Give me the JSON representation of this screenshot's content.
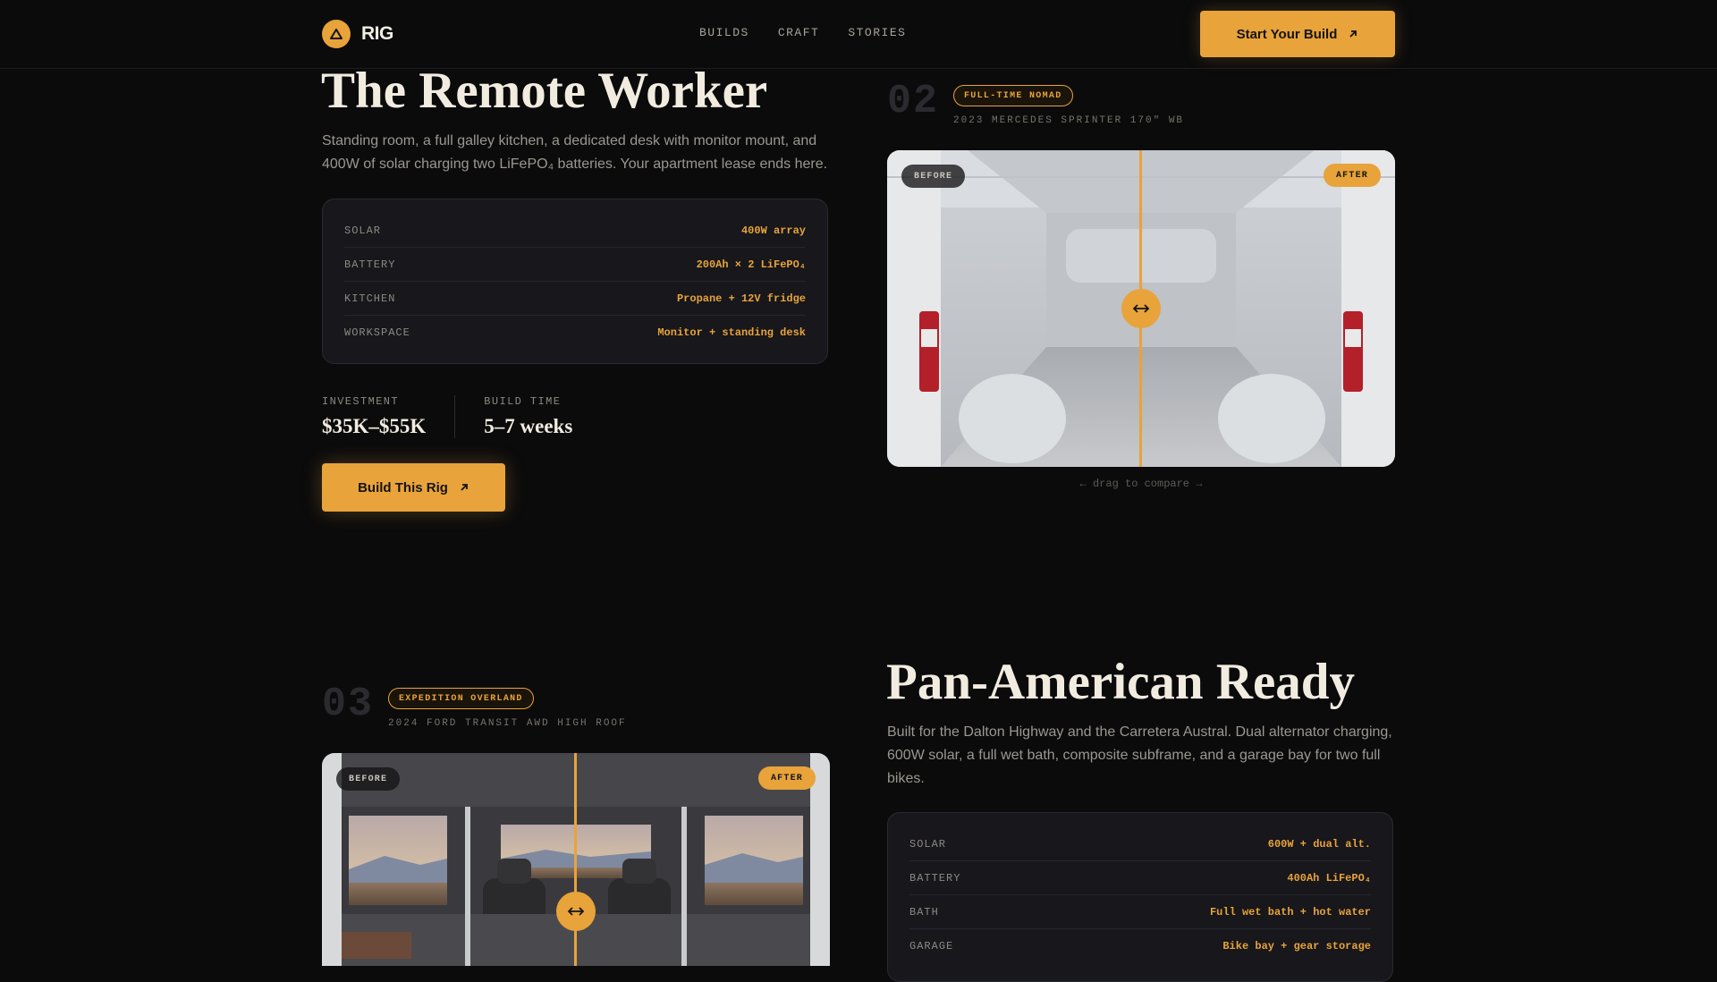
{
  "brand": {
    "name": "RIG"
  },
  "nav": {
    "items": [
      "BUILDS",
      "CRAFT",
      "STORIES"
    ]
  },
  "header": {
    "cta_label": "Start Your Build"
  },
  "builds": [
    {
      "title": "The Remote Worker",
      "description": "Standing room, a full galley kitchen, a dedicated desk with monitor mount, and 400W of solar charging two LiFePO₄ batteries. Your apartment lease ends here.",
      "specs": [
        {
          "key": "SOLAR",
          "value": "400W array"
        },
        {
          "key": "BATTERY",
          "value": "200Ah × 2 LiFePO₄"
        },
        {
          "key": "KITCHEN",
          "value": "Propane + 12V fridge"
        },
        {
          "key": "WORKSPACE",
          "value": "Monitor + standing desk"
        }
      ],
      "investment_label": "INVESTMENT",
      "investment_value": "$35K–$55K",
      "build_time_label": "BUILD TIME",
      "build_time_value": "5–7 weeks",
      "cta_label": "Build This Rig"
    },
    {
      "number": "02",
      "badge": "FULL-TIME NOMAD",
      "vehicle": "2023 MERCEDES SPRINTER 170\" WB",
      "before_label": "BEFORE",
      "after_label": "AFTER",
      "hint": "← drag to compare →"
    },
    {
      "number": "03",
      "badge": "EXPEDITION OVERLAND",
      "vehicle": "2024 FORD TRANSIT AWD HIGH ROOF",
      "before_label": "BEFORE",
      "after_label": "AFTER",
      "title": "Pan-American Ready",
      "description": "Built for the Dalton Highway and the Carretera Austral. Dual alternator charging, 600W solar, a full wet bath, composite subframe, and a garage bay for two full bikes.",
      "specs": [
        {
          "key": "SOLAR",
          "value": "600W + dual alt."
        },
        {
          "key": "BATTERY",
          "value": "400Ah LiFePO₄"
        },
        {
          "key": "BATH",
          "value": "Full wet bath + hot water"
        },
        {
          "key": "GARAGE",
          "value": "Bike bay + gear storage"
        }
      ]
    }
  ],
  "colors": {
    "accent": "#e8a33a",
    "background": "#0b0b0c",
    "card": "#17171c"
  }
}
